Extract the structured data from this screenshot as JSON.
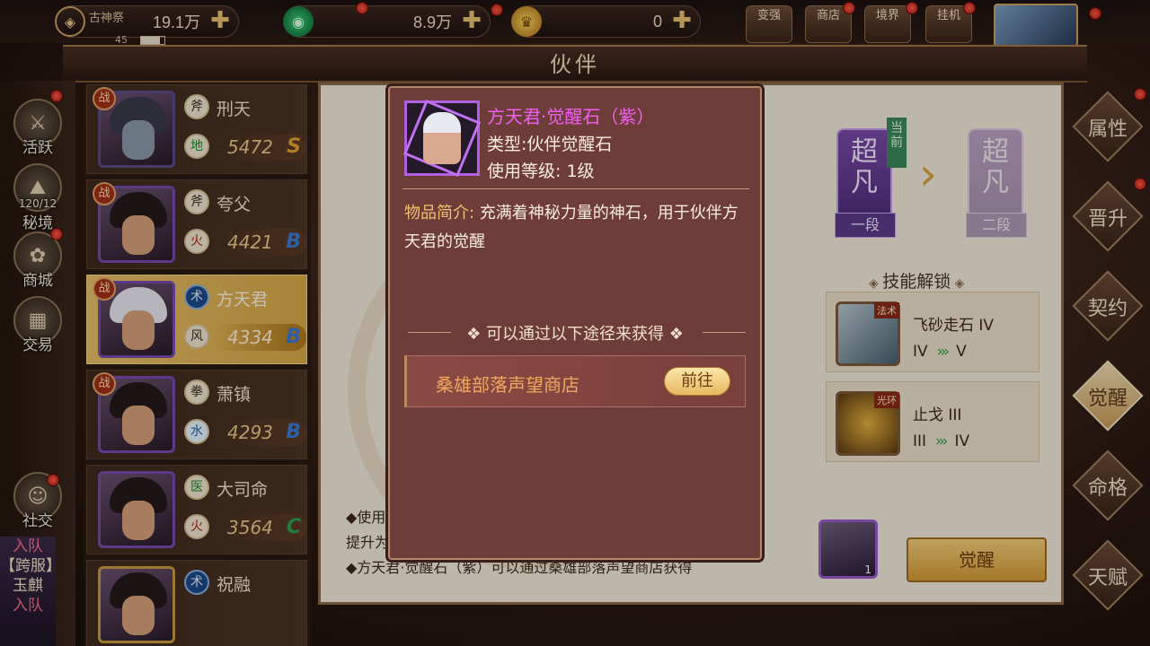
{
  "topbar": {
    "res1": {
      "tag": "古神祭",
      "value": "19.1万",
      "sub": "45"
    },
    "res2": {
      "value": "8.9万"
    },
    "res3": {
      "value": "0"
    },
    "buttons": [
      "变强",
      "商店",
      "境界",
      "挂机"
    ]
  },
  "title": "伙伴",
  "leftnav": [
    {
      "label": "活跃",
      "icon": "⚔"
    },
    {
      "label": "秘境",
      "icon": "⛰",
      "count": "120/12"
    },
    {
      "label": "商城",
      "icon": "✿"
    },
    {
      "label": "交易",
      "icon": "▦"
    },
    {
      "label": "社交",
      "icon": "☺"
    }
  ],
  "side_blue": [
    "入队",
    "【跨服】",
    "玉麒",
    "入队"
  ],
  "companions": [
    {
      "name": "刑天",
      "class": "斧",
      "element": "地",
      "power": "5472",
      "grade": "S",
      "battle": "战"
    },
    {
      "name": "夸父",
      "class": "斧",
      "element": "火",
      "power": "4421",
      "grade": "B",
      "battle": "战"
    },
    {
      "name": "方天君",
      "class": "术",
      "element": "风",
      "power": "4334",
      "grade": "B",
      "battle": "战"
    },
    {
      "name": "萧镇",
      "class": "拳",
      "element": "水",
      "power": "4293",
      "grade": "B",
      "battle": "战"
    },
    {
      "name": "大司命",
      "class": "医",
      "element": "火",
      "power": "3564",
      "grade": "C",
      "battle": ""
    },
    {
      "name": "祝融",
      "class": "术",
      "element": "",
      "power": "",
      "grade": "",
      "battle": ""
    }
  ],
  "main": {
    "rank_current": {
      "top": "超凡",
      "seg": "一段",
      "flag": "当前"
    },
    "rank_next": {
      "top": "超凡",
      "seg": "二段"
    },
    "skill_head": "技能解锁",
    "skills": [
      {
        "tag": "法术",
        "name": "飞砂走石 IV",
        "from": "IV",
        "to": "V"
      },
      {
        "tag": "光环",
        "name": "止戈 III",
        "from": "III",
        "to": "IV"
      }
    ],
    "desc1": "◆使用",
    "desc2": "提升为",
    "desc3": "◆方天君·觉醒石（紫）可以通过桑雄部落声望商店获得",
    "item_count": "1",
    "awaken_button": "觉醒"
  },
  "right_tabs": [
    "属性",
    "晋升",
    "契约",
    "觉醒",
    "命格",
    "天赋"
  ],
  "right_active": "觉醒",
  "popup": {
    "name": "方天君·觉醒石（紫）",
    "type": "类型:伙伴觉醒石",
    "level": "使用等级: 1级",
    "intro_key": "物品简介:",
    "intro_text": "充满着神秘力量的神石，用于伙伴方天君的觉醒",
    "ways": "❖ 可以通过以下途径来获得 ❖",
    "source_name": "桑雄部落声望商店",
    "go_button": "前往"
  },
  "colors": {
    "grade_S": "#e0a030",
    "grade_B": "#3a7ad8",
    "grade_C": "#2aa050",
    "popup_name": "#f060f0"
  }
}
